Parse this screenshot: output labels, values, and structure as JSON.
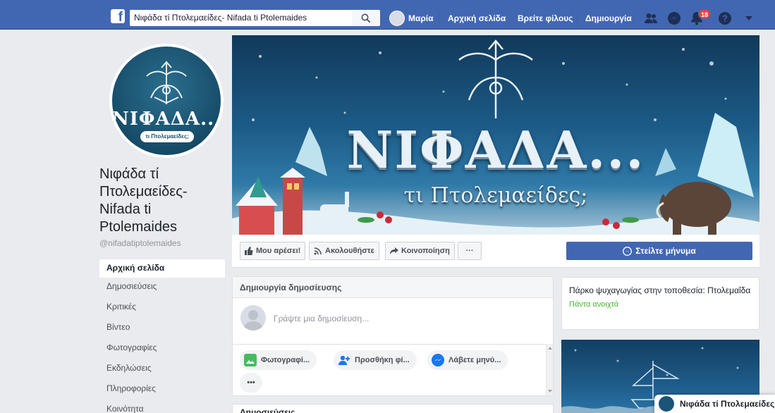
{
  "topbar": {
    "search_value": "Νιφάδα τί Πτολεμαείδες- Nifada ti Ptolemaides",
    "user_name": "Μαρία",
    "links": [
      "Αρχική σελίδα",
      "Βρείτε φίλους",
      "Δημιουργία"
    ],
    "notifications_count": "18"
  },
  "page": {
    "profile_title": "ΝΙΦΑΔΑ...",
    "profile_sub": "τι Πτολεμαείδες;",
    "name": "Νιφάδα τί Πτολεμαείδες- Nifada ti Ptolemaides",
    "username": "@nifadatiptolemaides",
    "cover_title": "ΝΙΦΑΔΑ...",
    "cover_sub": "τι Πτολεμαείδες;"
  },
  "left_nav": [
    "Αρχική σελίδα",
    "Δημοσιεύσεις",
    "Κριτικές",
    "Βίντεο",
    "Φωτογραφίες",
    "Εκδηλώσεις",
    "Πληροφορίες",
    "Κοινότητα"
  ],
  "actions": {
    "like": "Μου αρέσει!",
    "follow": "Ακολουθήστε",
    "share": "Κοινοποίηση",
    "more": "···",
    "message": "Στείλτε μήνυμα"
  },
  "composer": {
    "title": "Δημιουργία δημοσίευσης",
    "placeholder": "Γράψτε μια δημοσίευση...",
    "chips": [
      "Φωτογραφί...",
      "Προσθήκη φί...",
      "Λάβετε μηνύ..."
    ],
    "more": "•••"
  },
  "info": {
    "text": "Πάρκο ψυχαγωγίας στην τοποθεσία: Πτολεμαΐδα",
    "status": "Πάντα ανοιχτά"
  },
  "below": {
    "title": "Δημοσιεύσεις"
  },
  "chat": {
    "name": "Νιφάδα τί Πτολεμαείδες"
  },
  "colors": {
    "brand": "#4267b2",
    "open_status": "#42b72a",
    "badge": "#fa3e3e"
  }
}
